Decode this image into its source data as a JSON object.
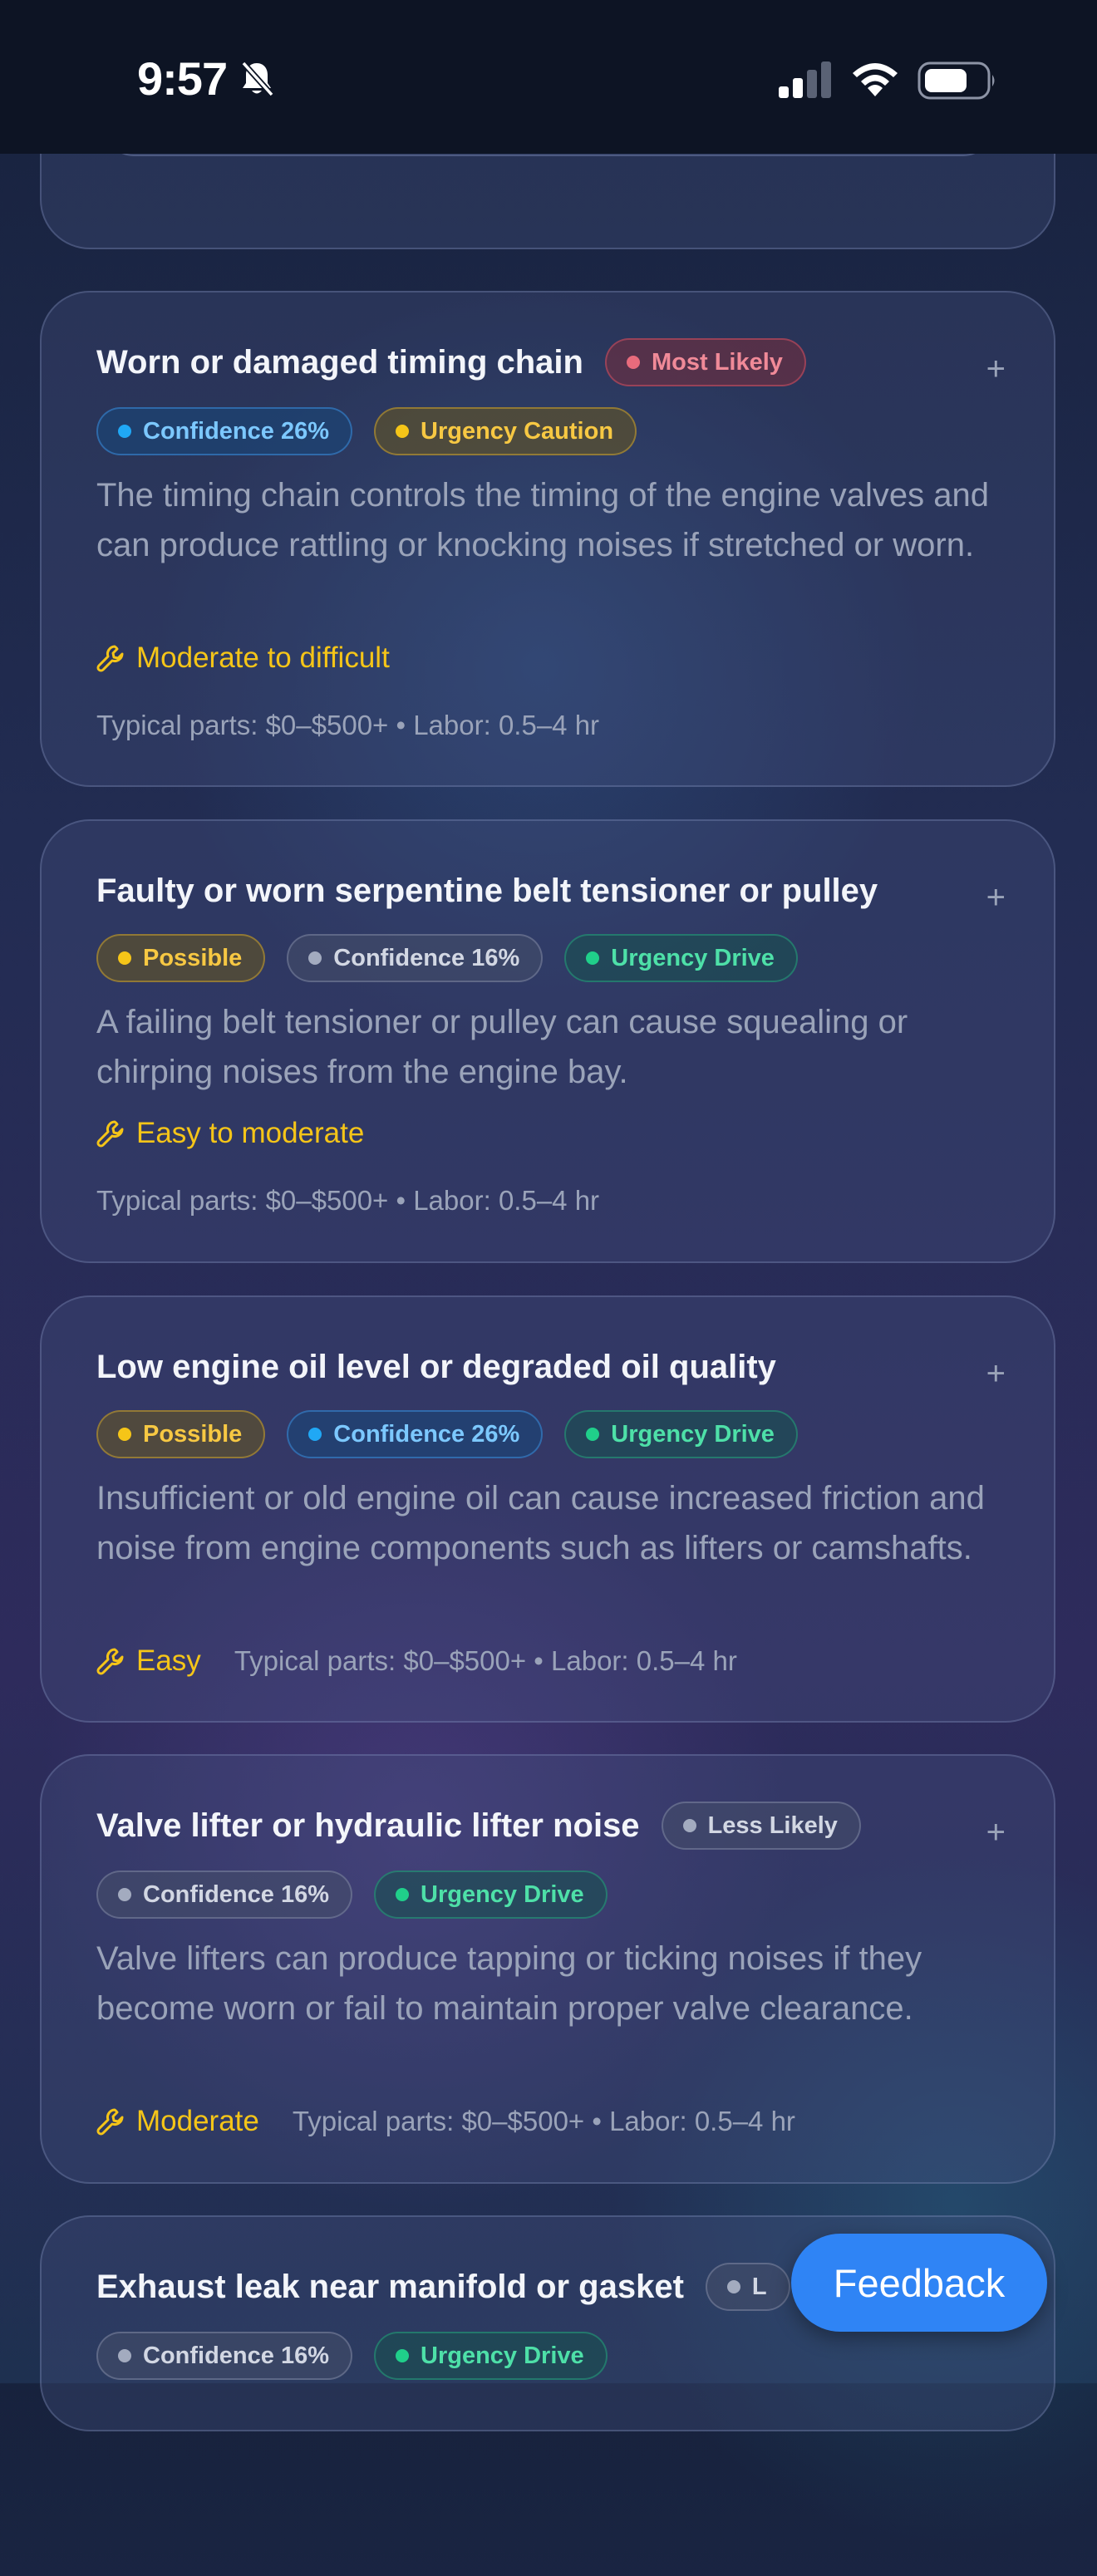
{
  "status": {
    "time": "9:57"
  },
  "cards": [
    {
      "title": "Worn or damaged timing chain",
      "likelihood": "Most Likely",
      "confidence": "Confidence 26%",
      "urgency": "Urgency Caution",
      "description": "The timing chain controls the timing of the engine valves and can produce rattling or knocking noises if stretched or worn.",
      "difficulty": "Moderate to difficult",
      "parts": "Typical parts: $0–$500+ • Labor: 0.5–4 hr"
    },
    {
      "title": "Faulty or worn serpentine belt tensioner or pulley",
      "likelihood": "Possible",
      "confidence": "Confidence 16%",
      "urgency": "Urgency Drive",
      "description": "A failing belt tensioner or pulley can cause squealing or chirping noises from the engine bay.",
      "difficulty": "Easy to moderate",
      "parts": "Typical parts: $0–$500+ • Labor: 0.5–4 hr"
    },
    {
      "title": "Low engine oil level or degraded oil quality",
      "likelihood": "Possible",
      "confidence": "Confidence 26%",
      "urgency": "Urgency Drive",
      "description": "Insufficient or old engine oil can cause increased friction and noise from engine components such as lifters or camshafts.",
      "difficulty": "Easy",
      "parts": "Typical parts: $0–$500+ • Labor: 0.5–4 hr"
    },
    {
      "title": "Valve lifter or hydraulic lifter noise",
      "likelihood": "Less Likely",
      "confidence": "Confidence 16%",
      "urgency": "Urgency Drive",
      "description": "Valve lifters can produce tapping or ticking noises if they become worn or fail to maintain proper valve clearance.",
      "difficulty": "Moderate",
      "parts": "Typical parts: $0–$500+ • Labor: 0.5–4 hr"
    },
    {
      "title": "Exhaust leak near manifold or gasket",
      "likelihood": "L",
      "confidence": "Confidence 16%",
      "urgency": "Urgency Drive"
    }
  ],
  "expand_symbol": "+",
  "feedback_label": "Feedback"
}
